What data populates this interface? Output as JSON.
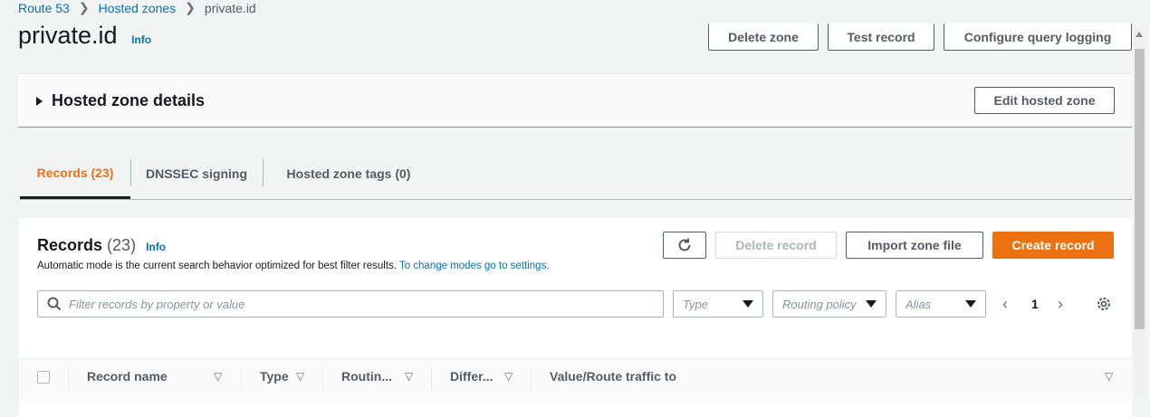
{
  "breadcrumb": {
    "items": [
      "Route 53",
      "Hosted zones"
    ],
    "current": "private.id",
    "separator": ">"
  },
  "page": {
    "title": "private.id",
    "info": "Info"
  },
  "header_buttons": {
    "delete_zone": "Delete zone",
    "test_record": "Test record",
    "configure_logging": "Configure query logging"
  },
  "details": {
    "title": "Hosted zone details",
    "edit_button": "Edit hosted zone"
  },
  "tabs": [
    {
      "label": "Records (23)",
      "active": true
    },
    {
      "label": "DNSSEC signing",
      "active": false
    },
    {
      "label": "Hosted zone tags (0)",
      "active": false
    }
  ],
  "records": {
    "title": "Records",
    "count": "(23)",
    "info": "Info",
    "description": "Automatic mode is the current search behavior optimized for best filter results.",
    "settings_link": "To change modes go to settings.",
    "refresh_icon": "refresh-icon",
    "delete_button": "Delete record",
    "import_button": "Import zone file",
    "create_button": "Create record"
  },
  "filters": {
    "search_placeholder": "Filter records by property or value",
    "type": "Type",
    "routing_policy": "Routing policy",
    "alias": "Alias",
    "page": "1"
  },
  "table": {
    "columns": [
      "Record name",
      "Type",
      "Routin...",
      "Differ...",
      "Value/Route traffic to"
    ]
  },
  "colors": {
    "accent": "#ec7211",
    "link": "#0073bb",
    "text": "#16191f",
    "muted": "#545b64"
  }
}
